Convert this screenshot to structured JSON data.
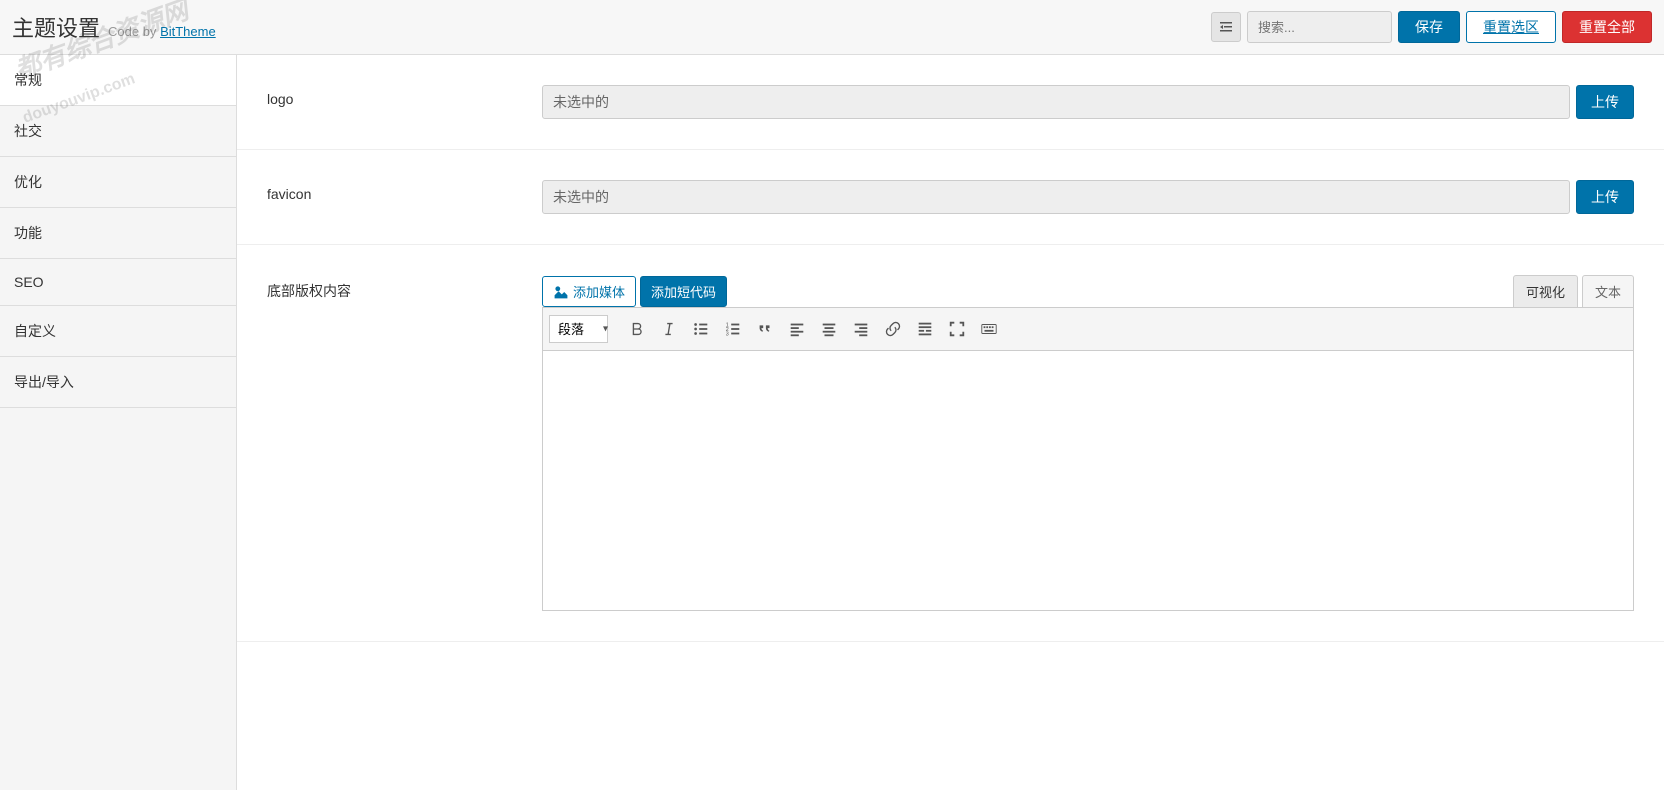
{
  "header": {
    "title": "主题设置",
    "codeByText": "Code by",
    "codeByLink": "BitTheme",
    "searchPlaceholder": "搜索...",
    "saveLabel": "保存",
    "resetSectionLabel": "重置选区",
    "resetAllLabel": "重置全部"
  },
  "sidebar": {
    "items": [
      {
        "label": "常规",
        "active": true
      },
      {
        "label": "社交",
        "active": false
      },
      {
        "label": "优化",
        "active": false
      },
      {
        "label": "功能",
        "active": false
      },
      {
        "label": "SEO",
        "active": false
      },
      {
        "label": "自定义",
        "active": false
      },
      {
        "label": "导出/导入",
        "active": false
      }
    ]
  },
  "fields": {
    "logo": {
      "label": "logo",
      "value": "未选中的",
      "uploadLabel": "上传"
    },
    "favicon": {
      "label": "favicon",
      "value": "未选中的",
      "uploadLabel": "上传"
    },
    "footer": {
      "label": "底部版权内容",
      "addMediaLabel": "添加媒体",
      "addShortcodeLabel": "添加短代码",
      "visualTabLabel": "可视化",
      "textTabLabel": "文本",
      "formatSelectLabel": "段落"
    }
  },
  "watermark": {
    "main": "都有综合资源网",
    "sub": "douyouvip.com"
  }
}
